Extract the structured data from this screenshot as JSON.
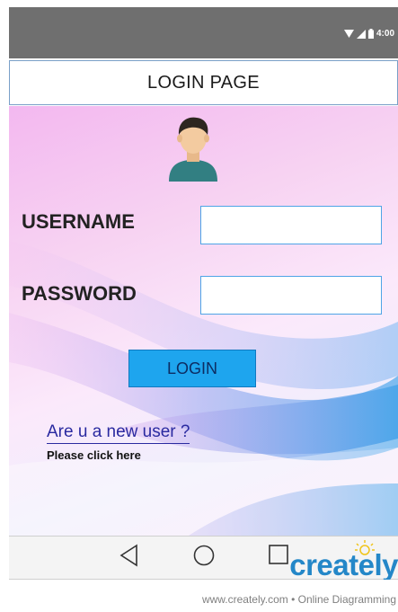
{
  "status_bar": {
    "time": "4:00"
  },
  "header": {
    "title": "LOGIN PAGE"
  },
  "form": {
    "username_label": "USERNAME",
    "username_value": "",
    "password_label": "PASSWORD",
    "password_value": "",
    "login_label": "LOGIN"
  },
  "new_user": {
    "question": "Are u a new user ?",
    "link": "Please click here"
  },
  "nav": [
    "back-icon",
    "home-icon",
    "recents-icon"
  ],
  "watermark": {
    "brand": "creately",
    "url": "www.creately.com • Online Diagramming"
  },
  "colors": {
    "status_bar": "#6f6f6f",
    "input_border": "#4fa4e6",
    "login_button": "#1ea5ee",
    "link": "#2a2aa0",
    "brand": "#2487c8"
  }
}
